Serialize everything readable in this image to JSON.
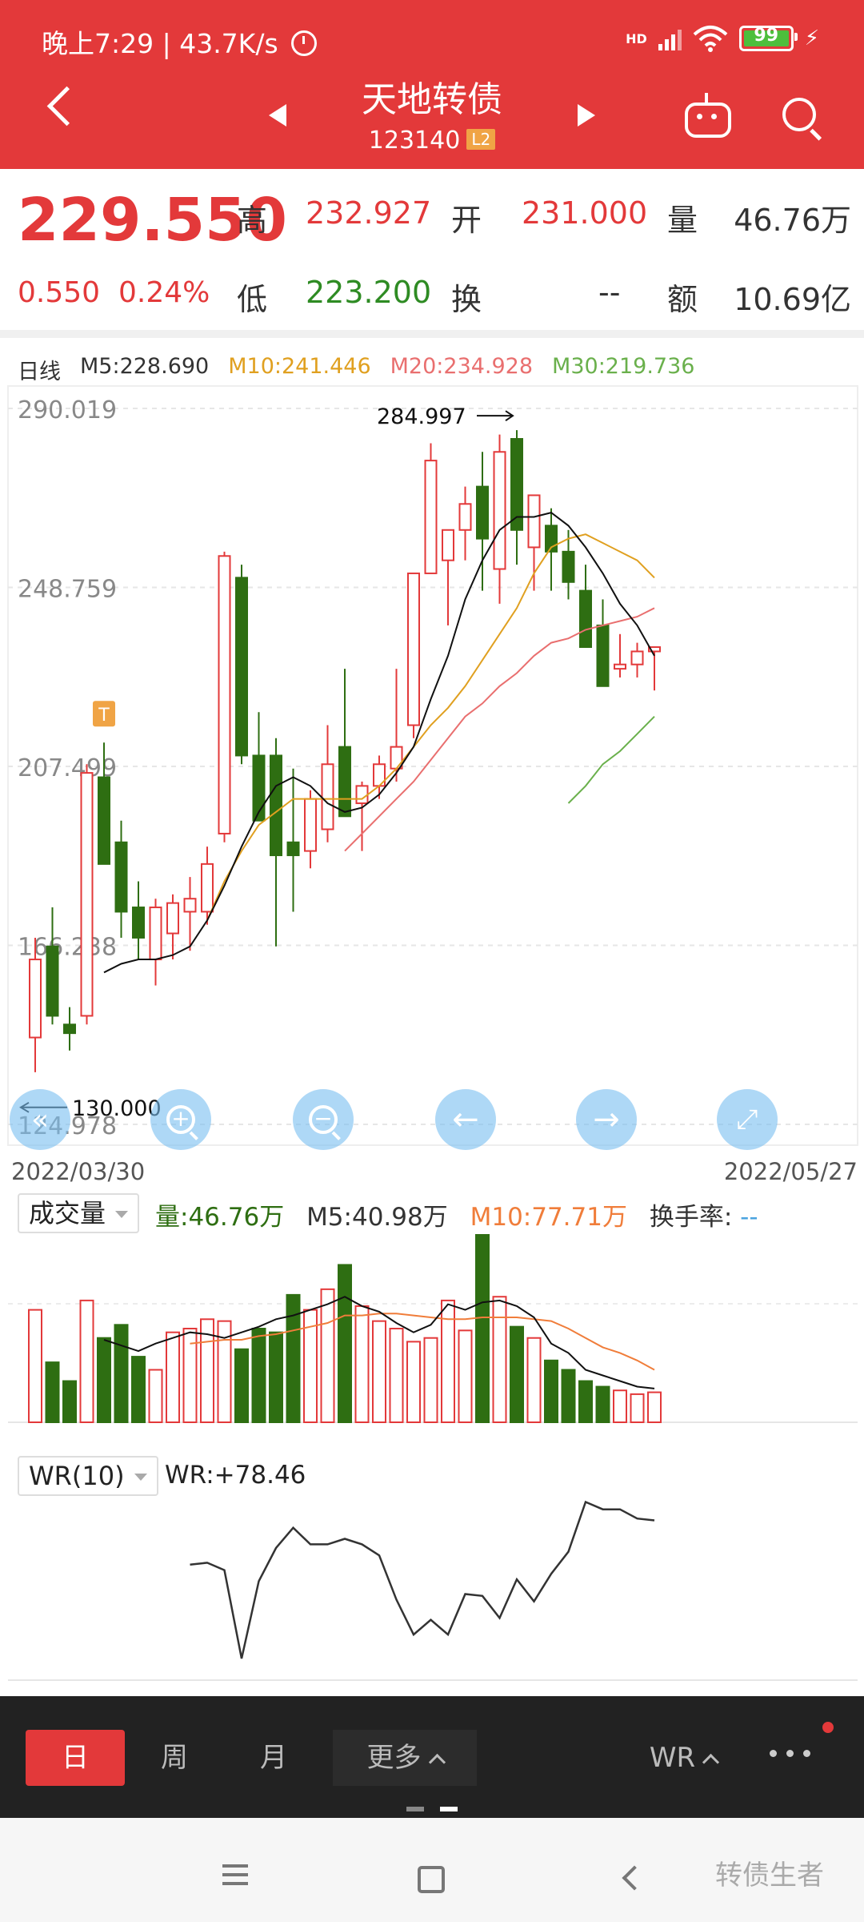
{
  "status_bar": {
    "time_speed": "晚上7:29 | 43.7K/s",
    "network": "HD",
    "battery": "99"
  },
  "header": {
    "title": "天地转债",
    "code": "123140",
    "badge": "L2"
  },
  "quote": {
    "price": "229.550",
    "change": "0.550",
    "change_pct": "0.24%",
    "high_label": "高",
    "high": "232.927",
    "open_label": "开",
    "open": "231.000",
    "vol_label": "量",
    "vol": "46.76万",
    "low_label": "低",
    "low": "223.200",
    "turnover_label": "换",
    "turnover": "--",
    "amount_label": "额",
    "amount": "10.69亿"
  },
  "ma_bar": {
    "period": "日线",
    "m5": "M5:228.690",
    "m10": "M10:241.446",
    "m20": "M20:234.928",
    "m30": "M30:219.736"
  },
  "colors": {
    "red": "#e3393a",
    "green": "#2e6e12",
    "m10": "#e0a020",
    "m20": "#e96f6f",
    "m30": "#6ab04c"
  },
  "chart_data": [
    {
      "type": "candlestick",
      "y_ticks": [
        "290.019",
        "248.759",
        "207.499",
        "166.238",
        "124.978"
      ],
      "ylim": [
        124.978,
        290.019
      ],
      "max_label": "284.997",
      "min_label": "130.000",
      "marker": "T",
      "date_start": "2022/03/30",
      "date_end": "2022/05/27",
      "candles": [
        {
          "o": 145,
          "h": 168,
          "l": 137,
          "c": 163
        },
        {
          "o": 166,
          "h": 175,
          "l": 148,
          "c": 150
        },
        {
          "o": 148,
          "h": 152,
          "l": 142,
          "c": 146
        },
        {
          "o": 150,
          "h": 208,
          "l": 148,
          "c": 206
        },
        {
          "o": 205,
          "h": 213,
          "l": 187,
          "c": 185
        },
        {
          "o": 190,
          "h": 195,
          "l": 168,
          "c": 174
        },
        {
          "o": 175,
          "h": 181,
          "l": 163,
          "c": 168
        },
        {
          "o": 163,
          "h": 177,
          "l": 157,
          "c": 175
        },
        {
          "o": 169,
          "h": 178,
          "l": 163,
          "c": 176
        },
        {
          "o": 174,
          "h": 182,
          "l": 165,
          "c": 177
        },
        {
          "o": 174,
          "h": 189,
          "l": 171,
          "c": 185
        },
        {
          "o": 192,
          "h": 257,
          "l": 190,
          "c": 256
        },
        {
          "o": 251,
          "h": 254,
          "l": 208,
          "c": 210
        },
        {
          "o": 210,
          "h": 220,
          "l": 197,
          "c": 195
        },
        {
          "o": 210,
          "h": 214,
          "l": 166,
          "c": 187
        },
        {
          "o": 190,
          "h": 207,
          "l": 174,
          "c": 187
        },
        {
          "o": 188,
          "h": 202,
          "l": 184,
          "c": 200
        },
        {
          "o": 193,
          "h": 217,
          "l": 190,
          "c": 208
        },
        {
          "o": 212,
          "h": 230,
          "l": 197,
          "c": 196
        },
        {
          "o": 199,
          "h": 204,
          "l": 188,
          "c": 203
        },
        {
          "o": 203,
          "h": 210,
          "l": 200,
          "c": 208
        },
        {
          "o": 207,
          "h": 230,
          "l": 204,
          "c": 212
        },
        {
          "o": 217,
          "h": 245,
          "l": 214,
          "c": 252
        },
        {
          "o": 252,
          "h": 282,
          "l": 255,
          "c": 278
        },
        {
          "o": 255,
          "h": 260,
          "l": 240,
          "c": 262
        },
        {
          "o": 262,
          "h": 272,
          "l": 255,
          "c": 268
        },
        {
          "o": 272,
          "h": 280,
          "l": 248,
          "c": 260
        },
        {
          "o": 253,
          "h": 284,
          "l": 245,
          "c": 280
        },
        {
          "o": 283,
          "h": 285,
          "l": 254,
          "c": 262
        },
        {
          "o": 258,
          "h": 259,
          "l": 248,
          "c": 270
        },
        {
          "o": 263,
          "h": 267,
          "l": 248,
          "c": 257
        },
        {
          "o": 257,
          "h": 262,
          "l": 246,
          "c": 250
        },
        {
          "o": 248,
          "h": 254,
          "l": 240,
          "c": 235
        },
        {
          "o": 240,
          "h": 246,
          "l": 233,
          "c": 226
        },
        {
          "o": 230,
          "h": 238,
          "l": 228,
          "c": 231
        },
        {
          "o": 231,
          "h": 236,
          "l": 228,
          "c": 234
        },
        {
          "o": 234,
          "h": 235,
          "l": 225,
          "c": 235
        }
      ],
      "ma5": [
        null,
        null,
        null,
        null,
        160,
        162,
        163,
        163,
        164,
        166,
        172,
        180,
        189,
        197,
        203,
        205,
        203,
        199,
        197,
        198,
        201,
        206,
        212,
        223,
        233,
        246,
        255,
        262,
        265,
        265,
        266,
        263,
        258,
        252,
        245,
        240,
        233
      ],
      "ma10": [
        null,
        null,
        null,
        null,
        null,
        null,
        null,
        null,
        null,
        null,
        172,
        181,
        188,
        194,
        197,
        200,
        200,
        200,
        200,
        200,
        203,
        207,
        212,
        217,
        221,
        226,
        232,
        238,
        244,
        252,
        258,
        260,
        261,
        259,
        257,
        255,
        251
      ],
      "ma20": [
        null,
        null,
        null,
        null,
        null,
        null,
        null,
        null,
        null,
        null,
        null,
        null,
        null,
        null,
        null,
        null,
        null,
        null,
        188,
        192,
        196,
        200,
        204,
        209,
        214,
        219,
        222,
        226,
        229,
        233,
        236,
        237,
        239,
        240,
        241,
        242,
        244
      ],
      "ma30": [
        null,
        null,
        null,
        null,
        null,
        null,
        null,
        null,
        null,
        null,
        null,
        null,
        null,
        null,
        null,
        null,
        null,
        null,
        null,
        null,
        null,
        null,
        null,
        null,
        null,
        null,
        null,
        null,
        null,
        null,
        null,
        199,
        203,
        208,
        211,
        215,
        219
      ]
    },
    {
      "type": "bar",
      "indicator": "成交量",
      "values": [
        60,
        32,
        22,
        65,
        45,
        52,
        35,
        28,
        48,
        50,
        55,
        54,
        39,
        50,
        48,
        68,
        60,
        71,
        84,
        62,
        54,
        50,
        43,
        45,
        65,
        49,
        100,
        67,
        51,
        45,
        33,
        28,
        22,
        19,
        17,
        15,
        16
      ],
      "ma5": [
        null,
        null,
        null,
        null,
        44,
        41,
        38,
        42,
        45,
        48,
        47,
        45,
        48,
        51,
        55,
        57,
        60,
        63,
        67,
        62,
        59,
        53,
        48,
        52,
        63,
        60,
        64,
        65,
        62,
        56,
        42,
        37,
        28,
        25,
        22,
        19,
        18
      ],
      "ma10": [
        null,
        null,
        null,
        null,
        null,
        null,
        null,
        null,
        null,
        42,
        43,
        44,
        44,
        46,
        47,
        49,
        51,
        53,
        57,
        57,
        58,
        58,
        57,
        56,
        55,
        55,
        56,
        56,
        56,
        55,
        54,
        50,
        45,
        40,
        37,
        33,
        28
      ]
    },
    {
      "type": "line",
      "indicator": "WR(10)",
      "values": [
        null,
        null,
        null,
        null,
        null,
        null,
        null,
        null,
        null,
        61,
        62,
        58,
        10,
        52,
        70,
        81,
        72,
        72,
        75,
        72,
        66,
        42,
        23,
        31,
        23,
        45,
        44,
        32,
        53,
        41,
        56,
        68,
        95,
        91,
        91,
        86,
        85
      ]
    }
  ],
  "volume_panel": {
    "label": "成交量",
    "vol": "量:46.76万",
    "m5": "M5:40.98万",
    "m10": "M10:77.71万",
    "turnover": "换手率:",
    "turnover_val": "--"
  },
  "wr_panel": {
    "label": "WR(10)",
    "value": "WR:+78.46"
  },
  "tabs": {
    "day": "日",
    "week": "周",
    "month": "月",
    "more": "更多",
    "indicator": "WR"
  },
  "watermark": "转债生者"
}
